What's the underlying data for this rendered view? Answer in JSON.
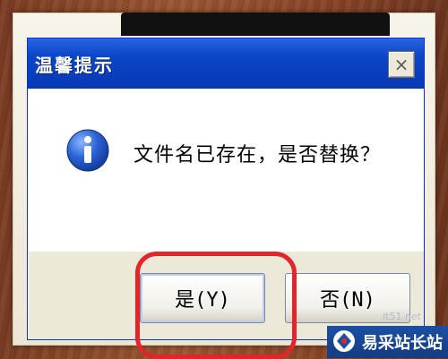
{
  "dialog": {
    "title": "温馨提示",
    "close_label": "×",
    "icon": "info-icon",
    "message": "文件名已存在，是否替换？",
    "buttons": {
      "yes_label": "是(Y)",
      "no_label": "否(N)"
    }
  },
  "watermark": {
    "brand": "易采站长站",
    "url": "it51.net"
  },
  "colors": {
    "titlebar": "#0a46c8",
    "highlight": "#e0262b",
    "dialog_bg": "#ece9d8"
  }
}
